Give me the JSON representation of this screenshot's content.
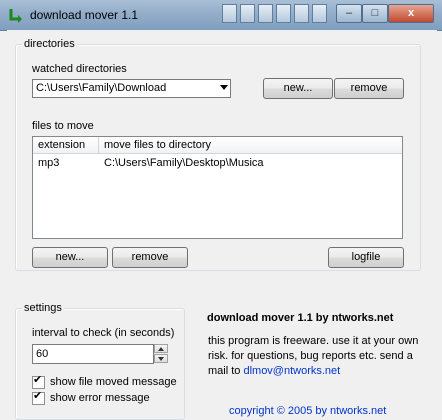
{
  "window": {
    "title": "download mover 1.1",
    "controls": {
      "minimize": "–",
      "maximize": "□",
      "close": "x"
    }
  },
  "directories": {
    "group_label": "directories",
    "watched_label": "watched directories",
    "selected_directory": "C:\\Users\\Family\\Download",
    "new_button": "new...",
    "remove_button": "remove"
  },
  "files": {
    "label": "files to move",
    "columns": [
      "extension",
      "move files to directory"
    ],
    "rows": [
      {
        "extension": "mp3",
        "directory": "C:\\Users\\Family\\Desktop\\Musica"
      }
    ],
    "new_button": "new...",
    "remove_button": "remove",
    "logfile_button": "logfile"
  },
  "settings": {
    "group_label": "settings",
    "interval_label": "interval to check (in seconds)",
    "interval_value": "60",
    "show_moved_label": "show file moved message",
    "show_moved_checked": true,
    "show_error_label": "show error message",
    "show_error_checked": true
  },
  "about": {
    "title": "download mover 1.1 by ntworks.net",
    "text_line1": "this program is freeware. use it at your own",
    "text_line2": "risk. for questions, bug reports etc. send a",
    "text_line3_prefix": "mail to",
    "email": "dlmov@ntworks.net",
    "copyright_partial": "copyright © 2005 by ntworks.net"
  },
  "colors": {
    "title_bar": "#93adc9",
    "close_button": "#c04a2e",
    "link": "#0033cc"
  }
}
